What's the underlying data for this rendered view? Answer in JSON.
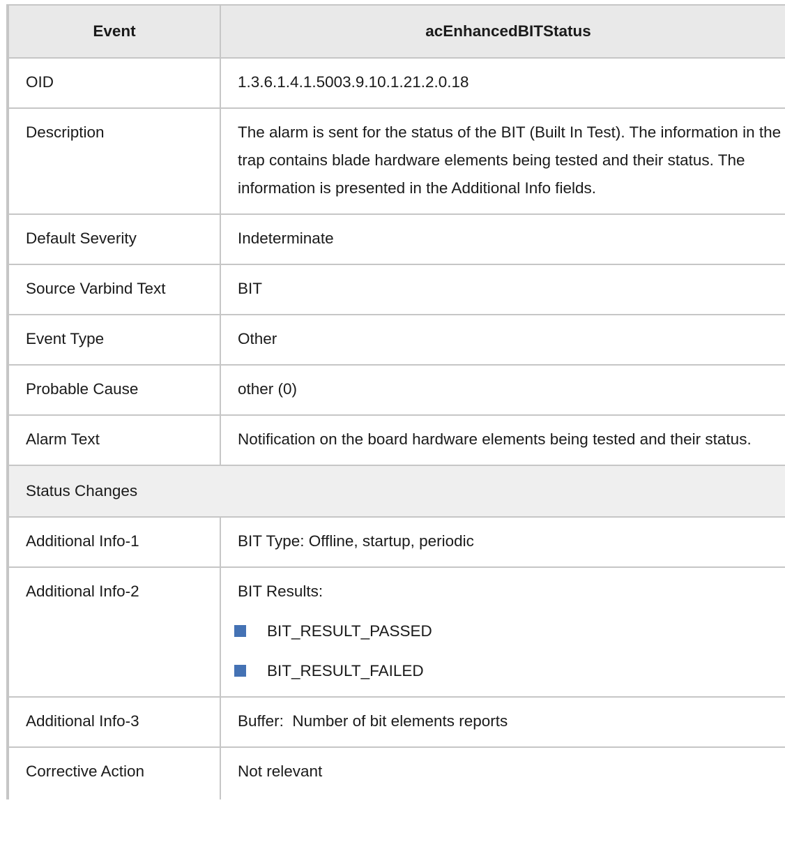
{
  "table": {
    "header": {
      "col1": "Event",
      "col2": "acEnhancedBITStatus"
    },
    "rows": {
      "oid": {
        "label": "OID",
        "value": "1.3.6.1.4.1.5003.9.10.1.21.2.0.18"
      },
      "description": {
        "label": "Description",
        "value": "The alarm is sent for the status of the BIT (Built In Test). The information in the trap contains blade hardware elements being tested and their status. The information is presented in the Additional Info fields."
      },
      "default_severity": {
        "label": "Default Severity",
        "value": "Indeterminate"
      },
      "source_varbind_text": {
        "label": "Source Varbind Text",
        "value": "BIT"
      },
      "event_type": {
        "label": "Event Type",
        "value": "Other"
      },
      "probable_cause": {
        "label": "Probable Cause",
        "value": "other (0)"
      },
      "alarm_text": {
        "label": "Alarm Text",
        "value": "Notification on the board hardware elements being tested and their status."
      },
      "status_changes": {
        "label": "Status Changes"
      },
      "additional_info_1": {
        "label": "Additional Info-1",
        "value": "BIT Type: Offline, startup, periodic"
      },
      "additional_info_2": {
        "label": "Additional Info-2",
        "intro": "BIT Results:",
        "items": [
          "BIT_RESULT_PASSED",
          "BIT_RESULT_FAILED"
        ]
      },
      "additional_info_3": {
        "label": "Additional Info-3",
        "value": "Buffer:  Number of bit elements reports"
      },
      "corrective_action": {
        "label": "Corrective Action",
        "value": "Not relevant"
      }
    }
  },
  "colors": {
    "header_bg": "#e9e9e9",
    "section_bg": "#efefef",
    "border": "#c6c6c6",
    "bullet": "#4472b4"
  }
}
